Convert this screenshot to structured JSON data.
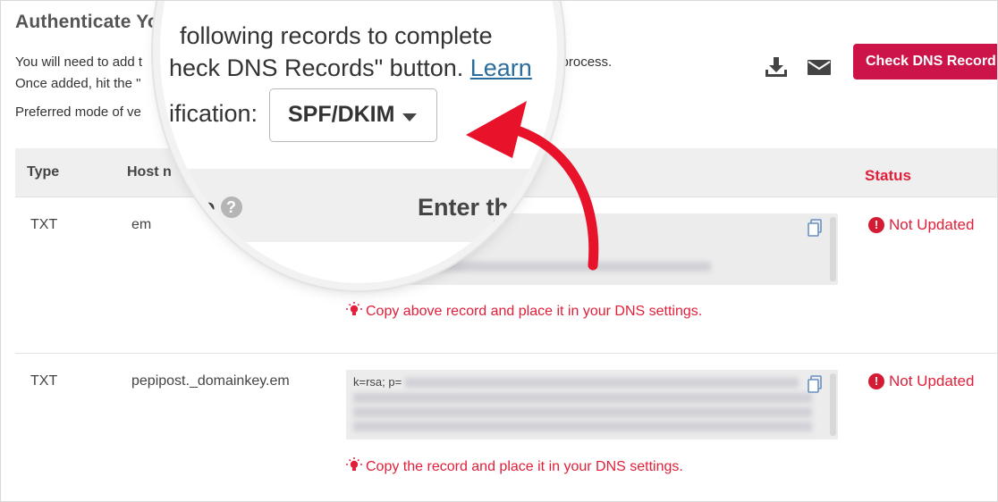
{
  "header": {
    "title": "Authenticate You",
    "instr_line1": "You will need to add t",
    "instr_line1_tail": "n process.",
    "instr_line2": "Once added, hit the \"",
    "instr_line3": "Preferred mode of ve",
    "check_button": "Check DNS Record"
  },
  "magnifier": {
    "line1": "following records to complete",
    "line2_prefix": "heck DNS Records\" button.",
    "line2_link": "Learn",
    "line3": "ification:",
    "select_value": "SPF/DKIM",
    "col_name": "ne",
    "col_enter": "Enter th",
    "value_hint": "37.ppspf.net ~all"
  },
  "table": {
    "headers": {
      "type": "Type",
      "host": "Host n",
      "status": "Status"
    },
    "rows": [
      {
        "type": "TXT",
        "host": "em",
        "value": "",
        "hint": "Copy above record and place it in your DNS settings.",
        "status": "Not Updated"
      },
      {
        "type": "TXT",
        "host": "pepipost._domainkey.em",
        "value": "k=rsa; p=",
        "hint": "Copy the record and place it in your DNS settings.",
        "status": "Not Updated"
      }
    ]
  },
  "icons": [
    "download-icon",
    "mail-icon",
    "copy-icon",
    "lightbulb-icon",
    "exclamation-icon",
    "help-icon",
    "caret-down-icon",
    "red-arrow"
  ],
  "colors": {
    "accent": "#cc1449",
    "error": "#e0203a",
    "link": "#2a6d9c",
    "header_bg": "#efefef"
  }
}
